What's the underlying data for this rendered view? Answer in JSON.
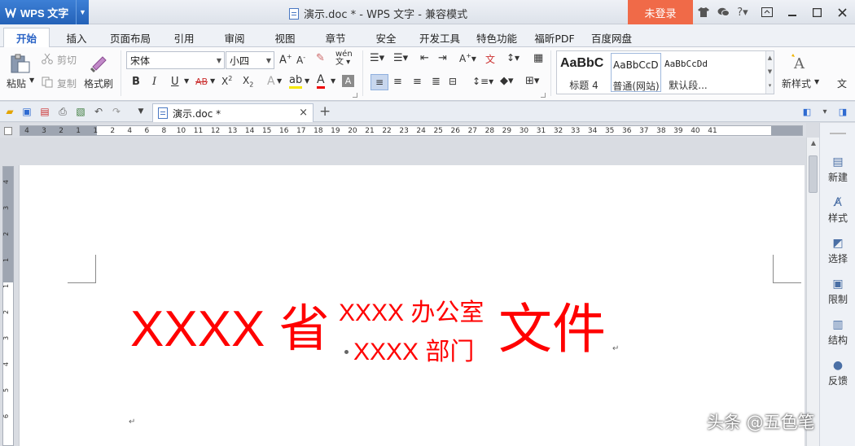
{
  "app": {
    "name": "WPS 文字",
    "window_title": "演示.doc * - WPS 文字 - 兼容模式",
    "login_label": "未登录"
  },
  "menu": {
    "tabs": [
      "开始",
      "插入",
      "页面布局",
      "引用",
      "审阅",
      "视图",
      "章节",
      "安全",
      "开发工具",
      "特色功能",
      "福昕PDF",
      "百度网盘"
    ]
  },
  "ribbon": {
    "paste": "粘贴",
    "cut": "剪切",
    "copy": "复制",
    "format_painter": "格式刷",
    "font_name": "宋体",
    "font_size": "小四",
    "new_style": "新样式",
    "text_overflow": "文",
    "styles": [
      {
        "sample": "AaBbC",
        "name": "标题 4"
      },
      {
        "sample": "AaBbCcD",
        "name": "普通(网站)"
      },
      {
        "sample": "AaBbCcDd",
        "name": "默认段..."
      }
    ]
  },
  "document": {
    "tab_label": "演示.doc *",
    "heading_left": "XXXX 省",
    "heading_line1": "XXXX 办公室",
    "heading_line2": "XXXX 部门",
    "heading_right": "文件",
    "paragraph_mark": "↵"
  },
  "ruler": {
    "h_numbers": [
      "4",
      "3",
      "2",
      "1",
      "1",
      "2",
      "4",
      "6",
      "8",
      "10",
      "11",
      "12",
      "13",
      "14",
      "15",
      "16",
      "17",
      "18",
      "19",
      "20",
      "21",
      "22",
      "23",
      "24",
      "25",
      "26",
      "27",
      "28",
      "29",
      "30",
      "31",
      "32",
      "33",
      "34",
      "35",
      "36",
      "37",
      "38",
      "39",
      "40",
      "41"
    ],
    "v_numbers": [
      "4",
      "3",
      "2",
      "1",
      "1",
      "2",
      "3",
      "4",
      "5",
      "6"
    ]
  },
  "taskpane": {
    "items": [
      "新建",
      "样式",
      "选择",
      "限制",
      "结构",
      "反馈"
    ]
  },
  "watermark": "头条 @五色笔",
  "colors": {
    "accent": "#2a63c5",
    "login_bg": "#f06a48",
    "heading_red": "#ff0000"
  }
}
